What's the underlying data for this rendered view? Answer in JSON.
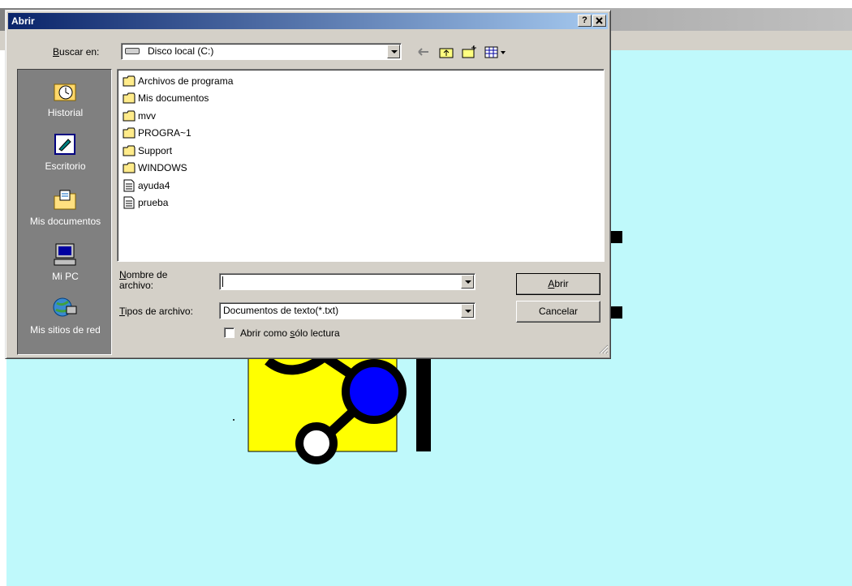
{
  "dialog": {
    "title": "Abrir",
    "help_label": "?",
    "close_label": "✕",
    "look_in": {
      "label_prefix": "B",
      "label_rest": "uscar en:",
      "value": "Disco local (C:)"
    },
    "places": [
      {
        "label": "Historial",
        "icon": "history-icon"
      },
      {
        "label": "Escritorio",
        "icon": "desktop-icon"
      },
      {
        "label": "Mis documentos",
        "icon": "my-documents-icon"
      },
      {
        "label": "Mi PC",
        "icon": "my-computer-icon"
      },
      {
        "label": "Mis sitios de red",
        "icon": "network-places-icon"
      }
    ],
    "files": [
      {
        "name": "Archivos de programa",
        "type": "folder"
      },
      {
        "name": "Mis documentos",
        "type": "folder"
      },
      {
        "name": "mvv",
        "type": "folder"
      },
      {
        "name": "PROGRA~1",
        "type": "folder"
      },
      {
        "name": "Support",
        "type": "folder"
      },
      {
        "name": "WINDOWS",
        "type": "folder"
      },
      {
        "name": "ayuda4",
        "type": "text-file"
      },
      {
        "name": "prueba",
        "type": "text-file"
      }
    ],
    "filename": {
      "label_prefix": "N",
      "label_rest": "ombre de",
      "label_line2": "archivo:",
      "value": ""
    },
    "filetype": {
      "label_prefix": "T",
      "label_rest": "ipos de archivo:",
      "value": "Documentos de texto(*.txt)"
    },
    "open_button": {
      "prefix": "A",
      "rest": "brir"
    },
    "cancel_button": "Cancelar",
    "readonly": {
      "before": "Abrir como ",
      "accel": "s",
      "after": "ólo lectura",
      "checked": false
    }
  },
  "colors": {
    "title_gradient_start": "#0a246a",
    "title_gradient_end": "#a6caf0",
    "dialog_face": "#d4d0c8",
    "places_bar": "#808080",
    "background_canvas": "#bff9fb",
    "drawing_yellow": "#ffff00",
    "drawing_blue": "#0000ff"
  }
}
